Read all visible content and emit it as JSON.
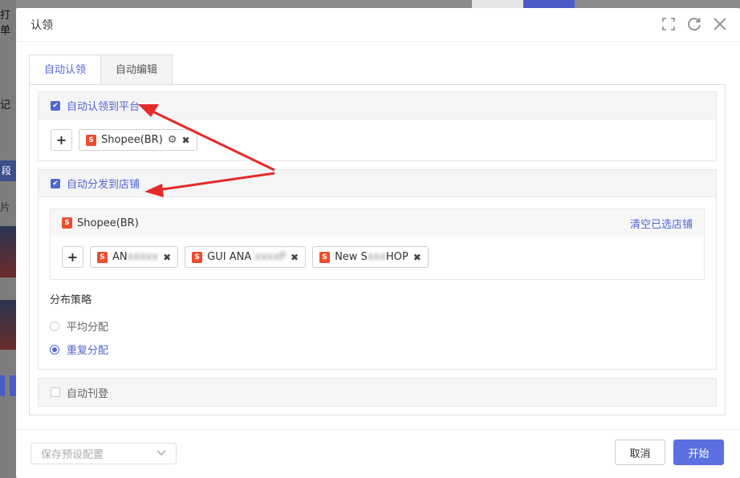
{
  "background": {
    "left_text_1": "打单",
    "left_text_2": "记",
    "left_band": "段",
    "left_text_3": "片"
  },
  "modal": {
    "title": "认领",
    "header_icons": [
      "fullscreen-icon",
      "refresh-icon",
      "close-icon"
    ]
  },
  "tabs": [
    {
      "label": "自动认领",
      "active": true
    },
    {
      "label": "自动编辑",
      "active": false
    }
  ],
  "section_platform": {
    "checked": true,
    "title": "自动认领到平台",
    "chips": [
      {
        "label": "Shopee(BR)"
      }
    ]
  },
  "section_store": {
    "checked": true,
    "title": "自动分发到店铺",
    "platform_label": "Shopee(BR)",
    "clear_link": "清空已选店铺",
    "stores": [
      {
        "prefix": "AN",
        "masked": "xxxxx"
      },
      {
        "prefix": "GUI ANA",
        "masked": "xxxxP"
      },
      {
        "prefix": "New S",
        "masked": "xxx",
        "suffix": "HOP"
      }
    ],
    "strategy_title": "分布策略",
    "options": [
      {
        "label": "平均分配",
        "selected": false
      },
      {
        "label": "重复分配",
        "selected": true
      }
    ]
  },
  "section_publish": {
    "checked": false,
    "title": "自动刊登"
  },
  "footer": {
    "preset_placeholder": "保存预设配置",
    "cancel": "取消",
    "start": "开始"
  },
  "colors": {
    "accent": "#4f66d3",
    "primary_button": "#5b6fe0",
    "shopee": "#ee4d2d",
    "arrow": "#e52a2a"
  }
}
